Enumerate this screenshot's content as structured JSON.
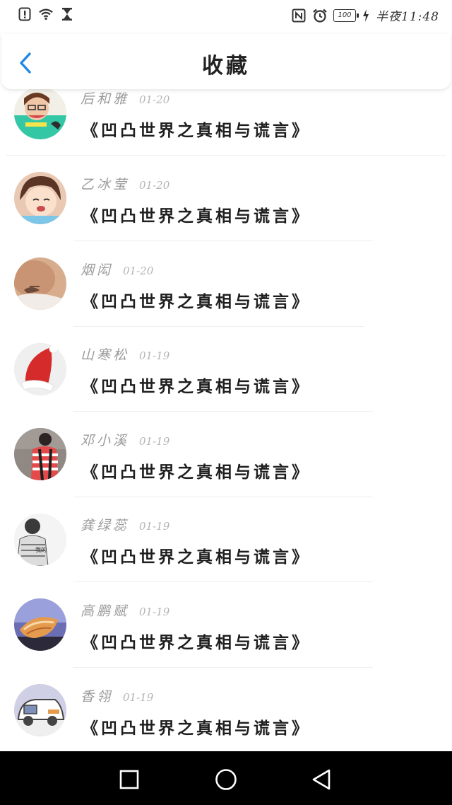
{
  "status_bar": {
    "time_label": "半夜11:48",
    "battery_level": "100",
    "icons": [
      "alert-icon",
      "wifi-icon",
      "hourglass-icon",
      "nfc-icon",
      "alarm-icon",
      "battery-icon",
      "charging-icon"
    ]
  },
  "header": {
    "title": "收藏",
    "back_icon": "chevron-left-icon"
  },
  "colors": {
    "accent": "#1e88e5",
    "name_text": "#9a9a9a",
    "date_text": "#b4b4b4",
    "book_text": "#1e1e1e",
    "nav_bg": "#000000"
  },
  "favorites": [
    {
      "name": "后和雅",
      "date": "01-20",
      "book": "《凹凸世界之真相与谎言》",
      "avatar": "avatar-cartoon-boy"
    },
    {
      "name": "乙冰莹",
      "date": "01-20",
      "book": "《凹凸世界之真相与谎言》",
      "avatar": "avatar-anime-girl"
    },
    {
      "name": "烟闳",
      "date": "01-20",
      "book": "《凹凸世界之真相与谎言》",
      "avatar": "avatar-tattoo-shoulder"
    },
    {
      "name": "山寒松",
      "date": "01-19",
      "book": "《凹凸世界之真相与谎言》",
      "avatar": "avatar-santa-hat"
    },
    {
      "name": "邓小溪",
      "date": "01-19",
      "book": "《凹凸世界之真相与谎言》",
      "avatar": "avatar-backpack-person"
    },
    {
      "name": "龚绿蕊",
      "date": "01-19",
      "book": "《凹凸世界之真相与谎言》",
      "avatar": "avatar-sketch-portrait"
    },
    {
      "name": "高鹏赋",
      "date": "01-19",
      "book": "《凹凸世界之真相与谎言》",
      "avatar": "avatar-seashell"
    },
    {
      "name": "香翎",
      "date": "01-19",
      "book": "《凹凸世界之真相与谎言》",
      "avatar": "avatar-cartoon-car"
    }
  ],
  "nav_bar": {
    "buttons": [
      "recent-apps-icon",
      "home-icon",
      "back-icon"
    ]
  }
}
